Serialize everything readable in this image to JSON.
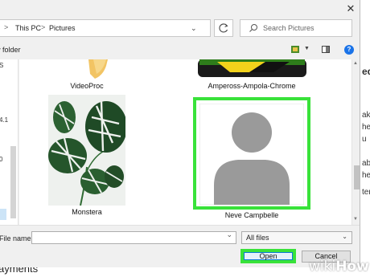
{
  "address": {
    "crumbs": [
      "This PC",
      "Pictures"
    ],
    "separator": ">"
  },
  "search": {
    "placeholder": "Search Pictures"
  },
  "toolbar": {
    "new_folder": "w folder"
  },
  "files": [
    {
      "name": "VideoProc",
      "selected": false
    },
    {
      "name": "Ampeross-Ampola-Chrome",
      "selected": false
    },
    {
      "name": "Monstera",
      "selected": false
    },
    {
      "name": "Neve Campbelle",
      "selected": true
    }
  ],
  "bottom": {
    "file_name_label": "File name:",
    "file_type": "All files",
    "open_label": "Open",
    "cancel_label": "Cancel"
  },
  "background": {
    "right_fragments": [
      "ed",
      "ake",
      "he",
      "u",
      "able",
      "hec",
      "tem"
    ],
    "bottom_text": "ayments",
    "left_fragments": [
      "S",
      "4.1",
      "0"
    ]
  },
  "watermark": {
    "wiki": "wiki",
    "how": "How"
  },
  "colors": {
    "highlight": "#39e23a",
    "accent": "#0b78d7"
  }
}
